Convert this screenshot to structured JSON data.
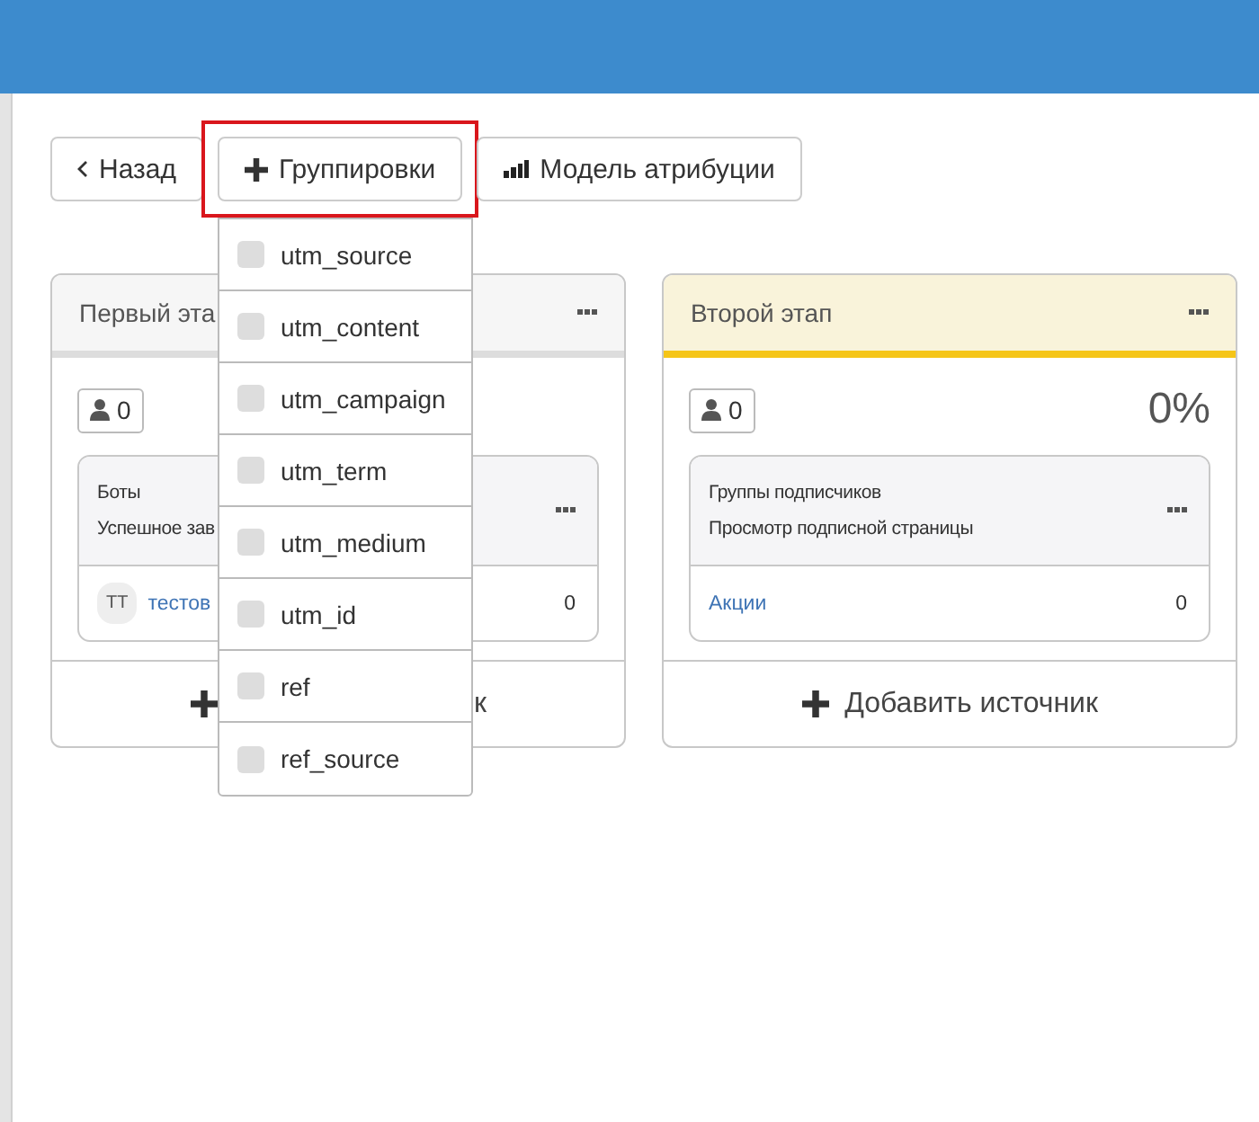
{
  "buttons": [
    {
      "kind": "back",
      "label": "Назад",
      "highlighted": false
    },
    {
      "kind": "add",
      "label": "Группировки",
      "highlighted": true
    },
    {
      "kind": "bars",
      "label": "Модель атрибуции",
      "highlighted": false
    }
  ],
  "grouping_menu": {
    "items": [
      {
        "label": "utm_source",
        "checked": false
      },
      {
        "label": "utm_content",
        "checked": false
      },
      {
        "label": "utm_campaign",
        "checked": false
      },
      {
        "label": "utm_term",
        "checked": false
      },
      {
        "label": "utm_medium",
        "checked": false
      },
      {
        "label": "utm_id",
        "checked": false
      },
      {
        "label": "ref",
        "checked": false
      },
      {
        "label": "ref_source",
        "checked": false
      }
    ]
  },
  "stages": [
    {
      "title": "Первый эта",
      "color": "#dddddd",
      "count": "0",
      "sources": [
        {
          "title": "Боты",
          "subtitle": "Успешное зав",
          "avatar": "ТТ",
          "link": "тестов",
          "count": "0"
        }
      ],
      "add_label": "к"
    },
    {
      "title": "Второй этап",
      "color": "#f5c518",
      "count": "0",
      "percent": "0%",
      "sources": [
        {
          "title": "Группы подписчиков",
          "subtitle": "Просмотр подписной страницы",
          "link": "Акции",
          "count": "0"
        }
      ],
      "add_label": "Добавить источник"
    }
  ]
}
